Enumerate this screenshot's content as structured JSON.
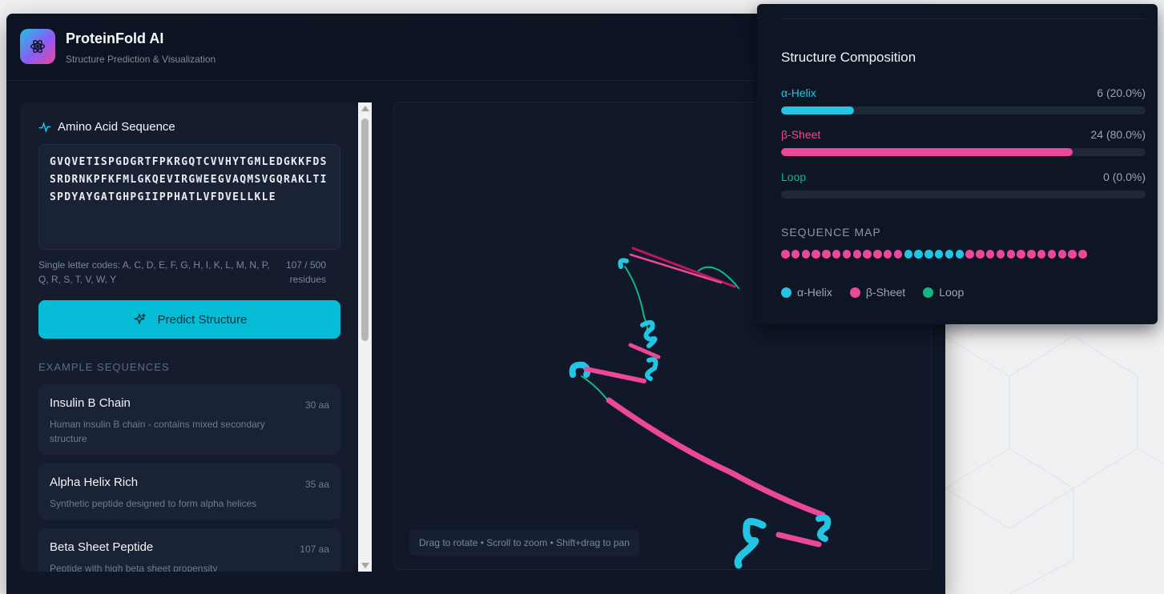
{
  "app": {
    "title": "ProteinFold AI",
    "subtitle": "Structure Prediction & Visualization"
  },
  "sequence": {
    "title": "Amino Acid Sequence",
    "value": "GVQVETISPGDGRTFPKRGQTCVVHYTGMLEDGKKFDSSRDRNKPFKFMLGKQEVIRGWEEGVAQMSVGQRAKLTISPDYAYGATGHPGIIPPHATLVFDVELLKLE",
    "codes_help": "Single letter codes: A, C, D, E, F, G, H, I, K, L, M, N, P, Q, R, S, T, V, W, Y",
    "count": "107 / 500 residues"
  },
  "predict_button": {
    "label": "Predict Structure"
  },
  "examples": {
    "title": "EXAMPLE SEQUENCES",
    "items": [
      {
        "name": "Insulin B Chain",
        "length": "30 aa",
        "desc": "Human insulin B chain - contains mixed secondary structure"
      },
      {
        "name": "Alpha Helix Rich",
        "length": "35 aa",
        "desc": "Synthetic peptide designed to form alpha helices"
      },
      {
        "name": "Beta Sheet Peptide",
        "length": "107 aa",
        "desc": "Peptide with high beta sheet propensity"
      }
    ]
  },
  "viewer": {
    "hint": "Drag to rotate • Scroll to zoom • Shift+drag to pan"
  },
  "composition": {
    "title": "Structure Composition",
    "rows": [
      {
        "label": "α-Helix",
        "value": "6 (20.0%)",
        "fraction": 0.2,
        "color": "#22c5e3"
      },
      {
        "label": "β-Sheet",
        "value": "24 (80.0%)",
        "fraction": 0.8,
        "color": "#ec4899"
      },
      {
        "label": "Loop",
        "value": "0 (0.0%)",
        "fraction": 0.0,
        "color": "#10b981"
      }
    ],
    "sequence_map_title": "SEQUENCE MAP",
    "sequence_map": [
      "S",
      "S",
      "S",
      "S",
      "S",
      "S",
      "S",
      "S",
      "S",
      "S",
      "S",
      "S",
      "H",
      "H",
      "H",
      "H",
      "H",
      "H",
      "S",
      "S",
      "S",
      "S",
      "S",
      "S",
      "S",
      "S",
      "S",
      "S",
      "S",
      "S"
    ],
    "legend": [
      {
        "label": "α-Helix",
        "color": "#22c5e3"
      },
      {
        "label": "β-Sheet",
        "color": "#ec4899"
      },
      {
        "label": "Loop",
        "color": "#10b981"
      }
    ]
  }
}
